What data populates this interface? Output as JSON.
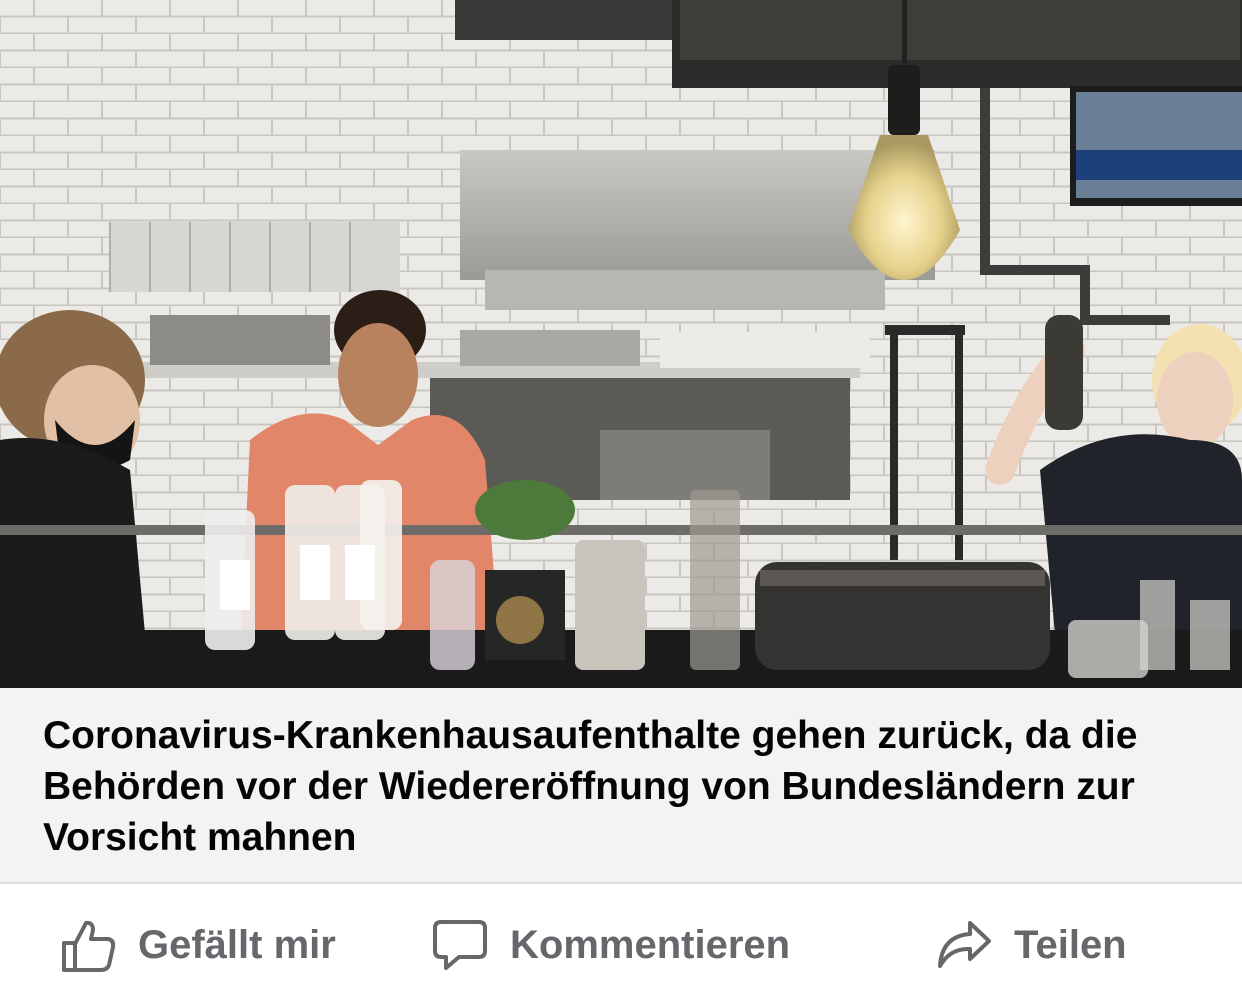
{
  "post": {
    "image_alt": "Bar interior with staff behind the counter",
    "headline": "Coronavirus-Krankenhausaufenthalte gehen zurück, da die Behörden vor der Wiedereröffnung von Bundesländern zur Vorsicht mahnen"
  },
  "actions": {
    "like_label": "Gefällt mir",
    "comment_label": "Kommentieren",
    "share_label": "Teilen",
    "like_icon": "thumbs-up-icon",
    "comment_icon": "speech-bubble-icon",
    "share_icon": "share-arrow-icon"
  },
  "colors": {
    "caption_bg": "#f2f3f5",
    "headline_text": "#050505",
    "action_text": "#65676b"
  }
}
